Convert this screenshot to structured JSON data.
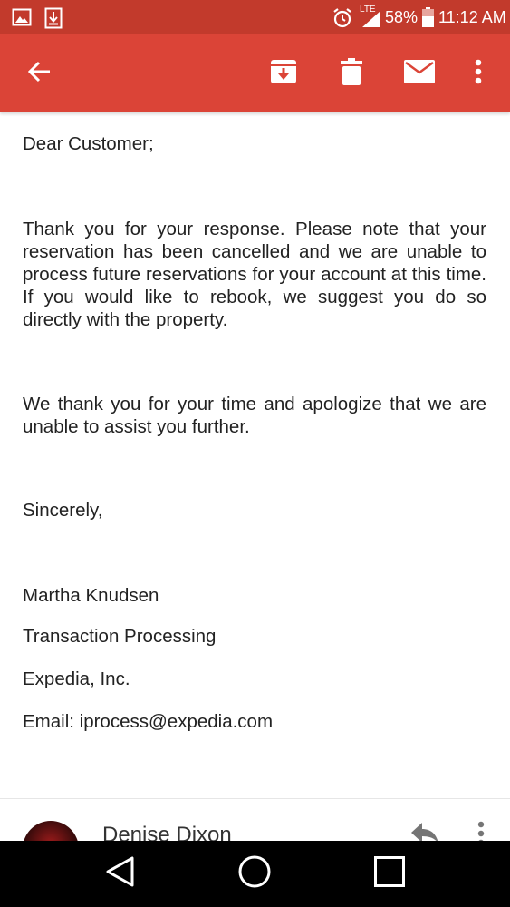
{
  "status_bar": {
    "network": "LTE",
    "battery": "58%",
    "time": "11:12 AM"
  },
  "toolbar": {
    "icons": [
      "back-arrow-icon",
      "archive-icon",
      "delete-icon",
      "mark-unread-icon",
      "overflow-menu-icon"
    ]
  },
  "email": {
    "greeting": "Dear Customer;",
    "paragraph1": "Thank you for your response. Please note that your reservation has been cancelled and we are unable to process future reservations for your account at this time. If you would like to rebook, we suggest you do so directly with the property.",
    "paragraph2": "We thank you for your time and apologize that we are unable to assist you further.",
    "closing": "Sincerely,",
    "signature_name": "Martha Knudsen",
    "signature_dept": "Transaction Processing",
    "signature_company": "Expedia, Inc.",
    "signature_email": "Email: iprocess@expedia.com"
  },
  "next_message": {
    "sender_name": "Denise Dixon"
  },
  "colors": {
    "status_bar": "#c23a2c",
    "app_bar": "#db4437"
  }
}
